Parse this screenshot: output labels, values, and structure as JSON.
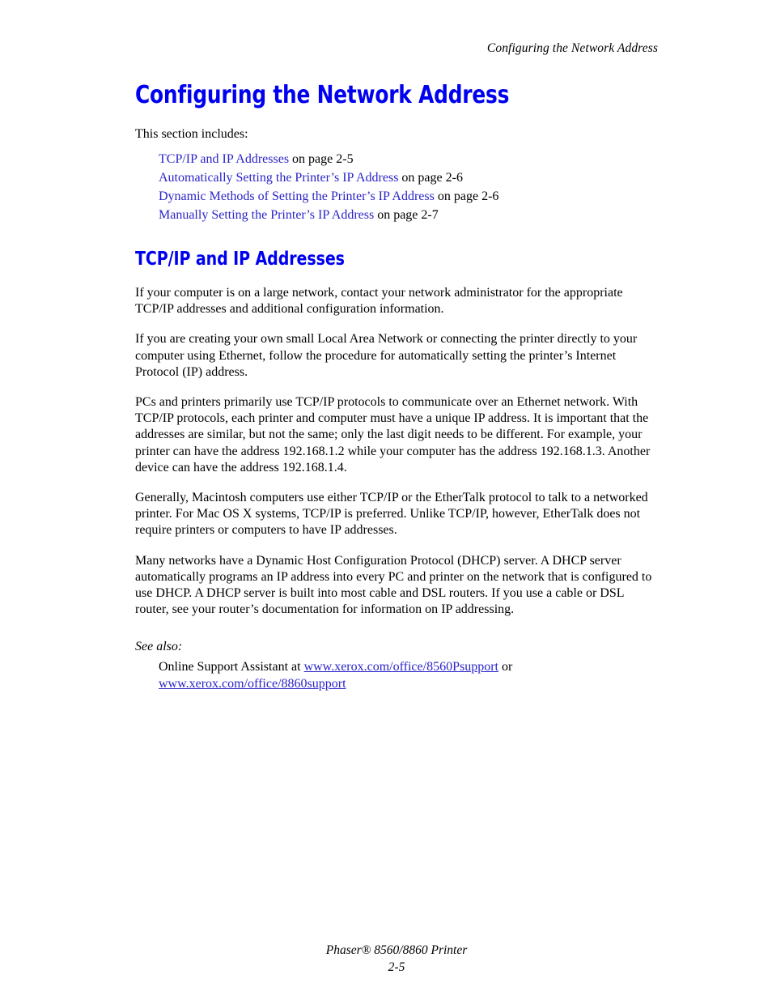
{
  "header": {
    "running_title": "Configuring the Network Address"
  },
  "chapter": {
    "title": "Configuring the Network Address",
    "intro": "This section includes:",
    "toc": [
      {
        "link": "TCP/IP and IP Addresses",
        "suffix": " on page 2-5"
      },
      {
        "link": "Automatically Setting the Printer’s IP Address",
        "suffix": " on page 2-6"
      },
      {
        "link": "Dynamic Methods of Setting the Printer’s IP Address",
        "suffix": " on page 2-6"
      },
      {
        "link": "Manually Setting the Printer’s IP Address",
        "suffix": " on page 2-7"
      }
    ]
  },
  "section": {
    "title": "TCP/IP and IP Addresses",
    "paragraphs": [
      "If your computer is on a large network, contact your network administrator for the appropriate TCP/IP addresses and additional configuration information.",
      "If you are creating your own small Local Area Network or connecting the printer directly to your computer using Ethernet, follow the procedure for automatically setting the printer’s Internet Protocol (IP) address.",
      "PCs and printers primarily use TCP/IP protocols to communicate over an Ethernet network. With TCP/IP protocols, each printer and computer must have a unique IP address. It is important that the addresses are similar, but not the same; only the last digit needs to be different. For example, your printer can have the address 192.168.1.2 while your computer has the address 192.168.1.3. Another device can have the address 192.168.1.4.",
      "Generally, Macintosh computers use either TCP/IP or the EtherTalk protocol to talk to a networked printer. For Mac OS X systems, TCP/IP is preferred. Unlike TCP/IP, however, EtherTalk does not require printers or computers to have IP addresses.",
      "Many networks have a Dynamic Host Configuration Protocol (DHCP) server. A DHCP server automatically programs an IP address into every PC and printer on the network that is configured to use DHCP. A DHCP server is built into most cable and DSL routers. If you use a cable or DSL router, see your router’s documentation for information on IP addressing."
    ]
  },
  "see_also": {
    "label": "See also:",
    "lead_text": "Online Support Assistant at ",
    "link_1": "www.xerox.com/office/8560Psupport",
    "conjunction": " or ",
    "link_2": "www.xerox.com/office/8860support"
  },
  "footer": {
    "product": "Phaser® 8560/8860 Printer",
    "page_number": "2-5"
  },
  "colors": {
    "heading_blue": "#0000f0",
    "link_blue": "#2a24c8",
    "text_black": "#000000",
    "page_background": "#ffffff"
  }
}
